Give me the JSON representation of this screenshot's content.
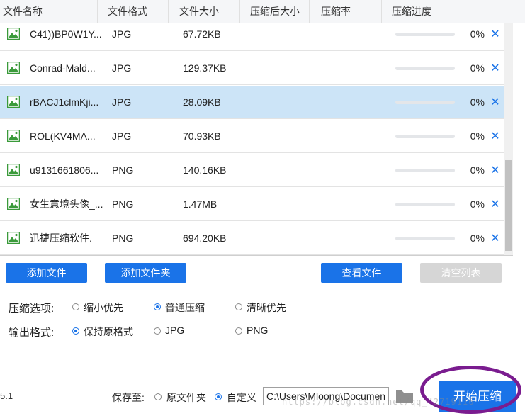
{
  "columns": [
    "文件名称",
    "文件格式",
    "文件大小",
    "压缩后大小",
    "压缩率",
    "压缩进度"
  ],
  "rows": [
    {
      "name": "C41))BP0W1Y...",
      "format": "JPG",
      "size": "67.72KB",
      "progress": 0,
      "pct": "0%"
    },
    {
      "name": "Conrad-Mald...",
      "format": "JPG",
      "size": "129.37KB",
      "progress": 0,
      "pct": "0%"
    },
    {
      "name": "rBACJ1clmKji...",
      "format": "JPG",
      "size": "28.09KB",
      "progress": 0,
      "pct": "0%"
    },
    {
      "name": "ROL(KV4MA...",
      "format": "JPG",
      "size": "70.93KB",
      "progress": 0,
      "pct": "0%"
    },
    {
      "name": "u9131661806...",
      "format": "PNG",
      "size": "140.16KB",
      "progress": 0,
      "pct": "0%"
    },
    {
      "name": "女生意境头像_...",
      "format": "PNG",
      "size": "1.47MB",
      "progress": 0,
      "pct": "0%"
    },
    {
      "name": "迅捷压缩软件.",
      "format": "PNG",
      "size": "694.20KB",
      "progress": 0,
      "pct": "0%"
    }
  ],
  "remove_glyph": "✕",
  "buttons": {
    "add_file": "添加文件",
    "add_folder": "添加文件夹",
    "view_file": "查看文件",
    "clear_list": "清空列表"
  },
  "options": {
    "compress_label": "压缩选项:",
    "compress": [
      "缩小优先",
      "普通压缩",
      "清晰优先"
    ],
    "compress_selected": 1,
    "format_label": "输出格式:",
    "format": [
      "保持原格式",
      "JPG",
      "PNG"
    ],
    "format_selected": 0
  },
  "footer": {
    "version": "5.1",
    "save_label": "保存至:",
    "save_options": [
      "原文件夹",
      "自定义"
    ],
    "save_selected": 1,
    "path_value": "C:\\Users\\Mloong\\Documents",
    "start_label": "开始压缩",
    "watermark": "https://blog.csdn.net/qq_42719116"
  },
  "colors": {
    "accent": "#1a73e8",
    "selected_row": "#cce4f7",
    "icon_green": "#3a9a3a",
    "annotation": "#7a1c8f"
  },
  "selected_row_index": 2
}
